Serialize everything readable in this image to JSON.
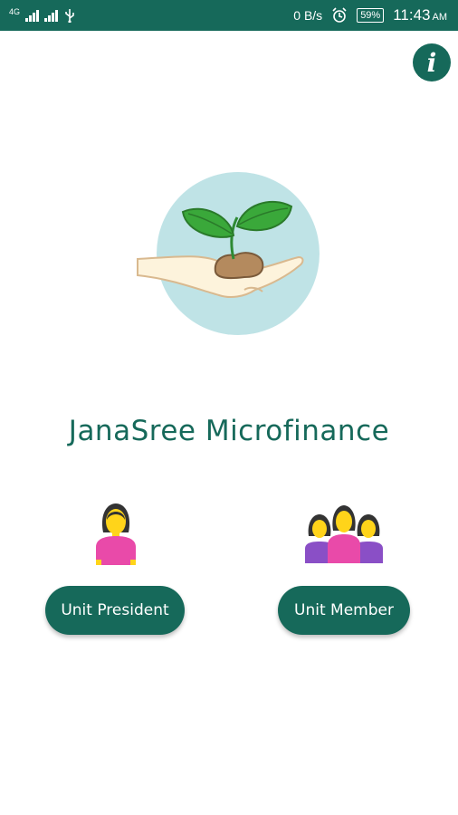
{
  "status_bar": {
    "network_label": "4G",
    "speed": "0 B/s",
    "battery": "59%",
    "time": "11:43",
    "ampm": "AM"
  },
  "header": {
    "info_icon": "info-icon"
  },
  "app": {
    "title": "JanaSree Microfinance"
  },
  "roles": {
    "president": {
      "label": "Unit President",
      "icon": "woman-icon"
    },
    "member": {
      "label": "Unit Member",
      "icon": "group-icon"
    }
  },
  "colors": {
    "primary": "#16695a",
    "logo_circle": "#bfe3e6",
    "leaf": "#3aa83a",
    "soil": "#b48a5e",
    "pink": "#e94aa9",
    "purple": "#8a4fc6",
    "skin": "#ffd41a"
  }
}
